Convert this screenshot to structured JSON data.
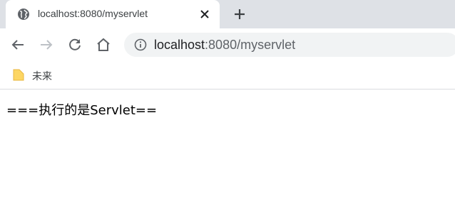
{
  "tab": {
    "title": "localhost:8080/myservlet",
    "favicon": "globe-icon"
  },
  "toolbar": {
    "url_host": "localhost",
    "url_path": ":8080/myservlet"
  },
  "bookmarks": [
    {
      "label": "未来",
      "icon": "folder-icon"
    }
  ],
  "page": {
    "output_text": "===执行的是Servlet=="
  },
  "colors": {
    "tabstrip": "#dee1e6",
    "omnibox": "#f1f3f4",
    "folder": "#fdd663"
  }
}
